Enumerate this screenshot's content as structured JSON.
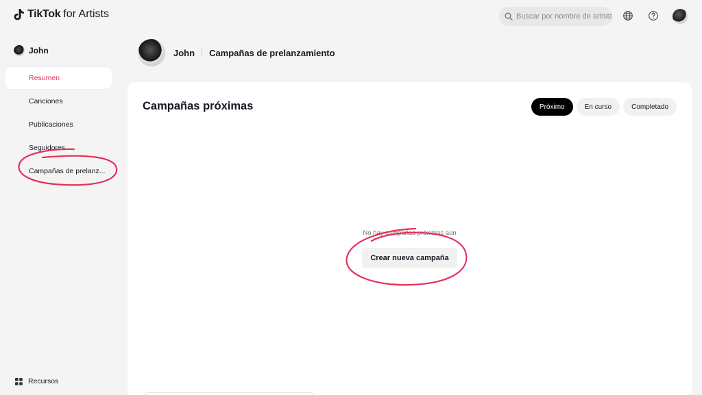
{
  "header": {
    "brand": "TikTok",
    "brand_suffix": "for Artists",
    "search_placeholder": "Buscar por nombre de artista",
    "icons": [
      "globe-icon",
      "help-icon",
      "avatar"
    ]
  },
  "sidebar": {
    "user_name": "John",
    "items": [
      {
        "label": "Resumen",
        "active": true
      },
      {
        "label": "Canciones",
        "active": false
      },
      {
        "label": "Publicaciones",
        "active": false
      },
      {
        "label": "Seguidores",
        "active": false
      },
      {
        "label": "Campañas de prelanz...",
        "active": false
      }
    ],
    "footer_label": "Recursos"
  },
  "page_header": {
    "artist_name": "John",
    "section_title": "Campañas de prelanzamiento"
  },
  "main": {
    "title": "Campañas próximas",
    "tabs": [
      {
        "label": "Próximo",
        "active": true
      },
      {
        "label": "En curso",
        "active": false
      },
      {
        "label": "Completado",
        "active": false
      }
    ],
    "empty_message": "No hay campañas próximas aún",
    "create_button": "Crear nueva campaña"
  },
  "colors": {
    "accent": "#e8315b",
    "annotation": "#e5305a",
    "background": "#f4f4f4",
    "card": "#ffffff"
  }
}
